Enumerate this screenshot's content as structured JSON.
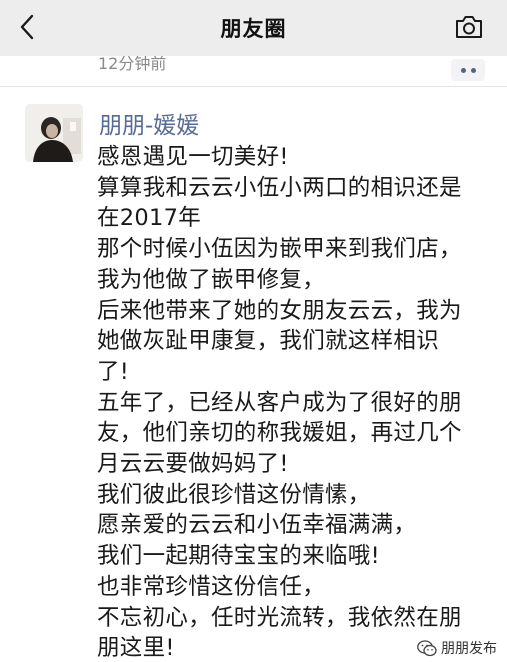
{
  "nav": {
    "title": "朋友圈",
    "back_icon": "chevron-left-icon",
    "camera_icon": "camera-icon"
  },
  "previous_post": {
    "time": "12分钟前"
  },
  "post": {
    "author": "朋朋-媛媛",
    "lines": [
      "感恩遇见一切美好!",
      "算算我和云云小伍小两口的相识还是",
      "在2017年",
      "那个时候小伍因为嵌甲来到我们店，",
      "我为他做了嵌甲修复，",
      "后来他带来了她的女朋友云云，我为",
      "她做灰趾甲康复，我们就这样相识",
      "了!",
      "五年了，已经从客户成为了很好的朋",
      "友，他们亲切的称我媛姐，再过几个",
      "月云云要做妈妈了!",
      "我们彼此很珍惜这份情愫，",
      "愿亲爱的云云和小伍幸福满满，",
      "我们一起期待宝宝的来临哦!",
      "也非常珍惜这份信任，",
      "不忘初心，任时光流转，我依然在朋",
      "朋这里!"
    ]
  },
  "watermark": {
    "text": "朋朋发布"
  },
  "colors": {
    "link": "#576b95",
    "navbar_bg": "#ededed",
    "text": "#1a1a1a"
  }
}
